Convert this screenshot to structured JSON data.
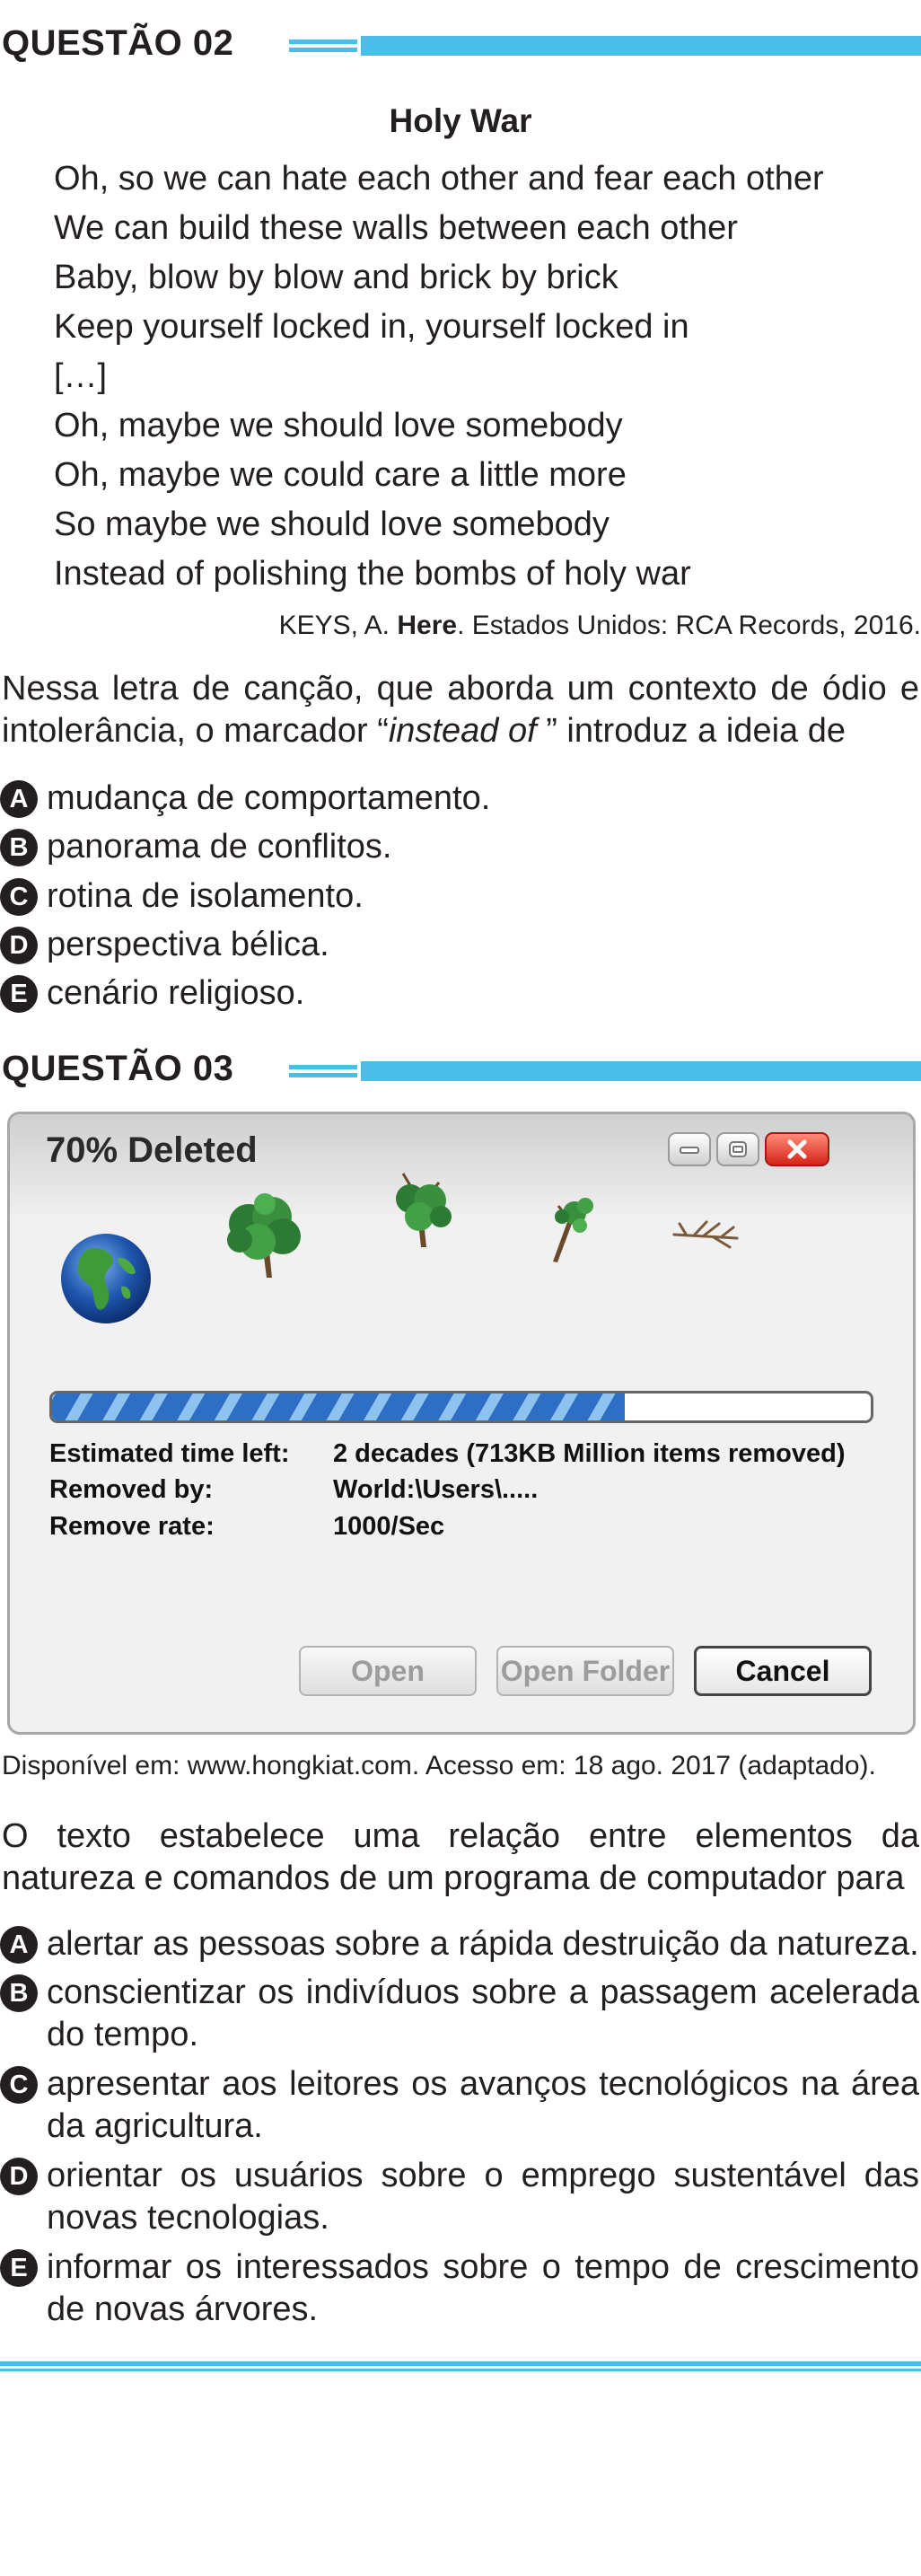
{
  "q2": {
    "heading": "QUESTÃO 02",
    "poem_title": "Holy War",
    "lines": [
      "Oh, so we can hate each other and fear each other",
      "We can build these walls between each other",
      "Baby, blow by blow and brick by brick",
      "Keep yourself locked in, yourself locked in",
      "[…]",
      "Oh, maybe we should love somebody",
      "Oh, maybe we could care a little more",
      "So maybe we should love somebody",
      "Instead of polishing the bombs of holy war"
    ],
    "credit": {
      "pre": "KEYS, A. ",
      "bold": "Here",
      "post": ". Estados Unidos: RCA Records, 2016."
    },
    "stem": {
      "pre": "Nessa letra de canção, que aborda um contexto de ódio e intolerância, o marcador “",
      "italic": "instead of",
      "post": " ” introduz a ideia de"
    },
    "options": [
      {
        "letter": "A",
        "text": "mudança de comportamento."
      },
      {
        "letter": "B",
        "text": "panorama de conflitos."
      },
      {
        "letter": "C",
        "text": "rotina de isolamento."
      },
      {
        "letter": "D",
        "text": "perspectiva bélica."
      },
      {
        "letter": "E",
        "text": "cenário religioso."
      }
    ]
  },
  "q3": {
    "heading": "QUESTÃO 03",
    "window": {
      "title": "70% Deleted",
      "progress_fraction": 0.7,
      "rows": [
        {
          "label": "Estimated time left:",
          "value": "2 decades (713KB Million items removed)"
        },
        {
          "label": "Removed by:",
          "value": "World:\\Users\\....."
        },
        {
          "label": "Remove rate:",
          "value": "1000/Sec"
        }
      ],
      "buttons": {
        "open": "Open",
        "open_folder": "Open Folder",
        "cancel": "Cancel"
      },
      "icons": [
        "globe-icon",
        "tree-full-icon",
        "tree-partial-icon",
        "tree-sparse-icon",
        "tree-bare-icon"
      ]
    },
    "source": "Disponível em: www.hongkiat.com. Acesso em: 18 ago. 2017 (adaptado).",
    "stem": "O texto estabelece uma relação entre elementos da natureza e comandos de um programa de computador para",
    "options": [
      {
        "letter": "A",
        "text": "alertar as pessoas sobre a rápida destruição da natureza."
      },
      {
        "letter": "B",
        "text": "conscientizar os indivíduos sobre a passagem acelerada do tempo."
      },
      {
        "letter": "C",
        "text": "apresentar aos leitores os avanços tecnológicos na área da agricultura."
      },
      {
        "letter": "D",
        "text": "orientar os usuários sobre o emprego sustentável das novas tecnologias."
      },
      {
        "letter": "E",
        "text": "informar os interessados sobre o tempo de crescimento de novas árvores."
      }
    ]
  },
  "colors": {
    "accent": "#4bbde9",
    "text": "#231f20",
    "close_button": "#d5251a",
    "progress_fill": "#2e6ec4"
  }
}
